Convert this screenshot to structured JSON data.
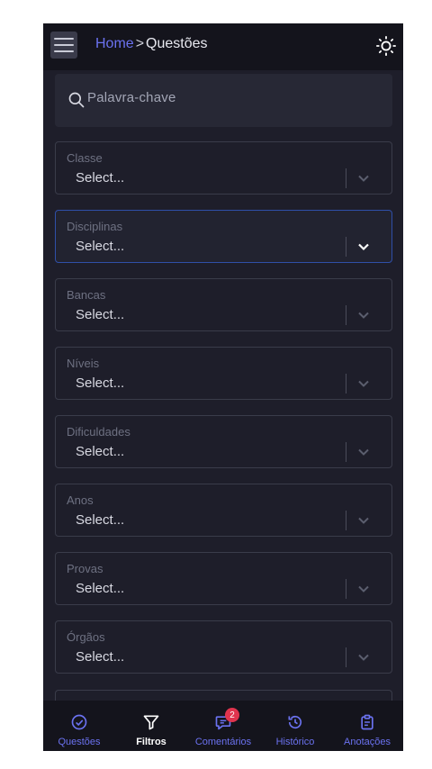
{
  "header": {
    "breadcrumb_home": "Home",
    "breadcrumb_separator": ">",
    "breadcrumb_current": "Questões",
    "menu_icon": "hamburger-icon",
    "theme_icon": "sun-icon"
  },
  "search": {
    "placeholder": "Palavra-chave",
    "icon": "search-icon"
  },
  "filters": [
    {
      "label": "Classe",
      "value": "Select..."
    },
    {
      "label": "Disciplinas",
      "value": "Select..."
    },
    {
      "label": "Bancas",
      "value": "Select..."
    },
    {
      "label": "Níveis",
      "value": "Select..."
    },
    {
      "label": "Dificuldades",
      "value": "Select..."
    },
    {
      "label": "Anos",
      "value": "Select..."
    },
    {
      "label": "Provas",
      "value": "Select..."
    },
    {
      "label": "Órgãos",
      "value": "Select..."
    }
  ],
  "nav": {
    "items": [
      {
        "label": "Questões",
        "icon": "check-circle-icon"
      },
      {
        "label": "Filtros",
        "icon": "filter-icon"
      },
      {
        "label": "Comentários",
        "icon": "chat-bubble-icon",
        "badge": "2"
      },
      {
        "label": "Histórico",
        "icon": "history-icon"
      },
      {
        "label": "Anotações",
        "icon": "clipboard-icon"
      }
    ]
  },
  "colors": {
    "background": "#1e1e2a",
    "header_bg": "#14141c",
    "accent": "#6b72f0",
    "badge": "#e0344e",
    "focus_border": "#2f4fa8"
  }
}
